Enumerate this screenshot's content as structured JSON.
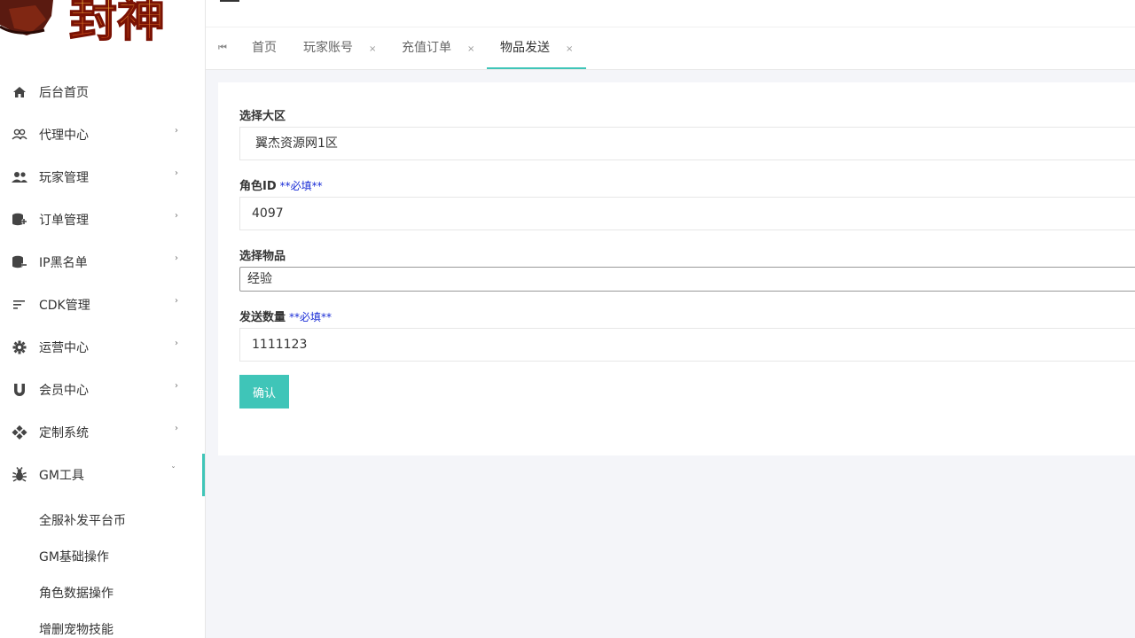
{
  "logo": {
    "text": "封神"
  },
  "sidebar": {
    "items": [
      {
        "label": "后台首页",
        "icon": "home-icon",
        "chevron": ""
      },
      {
        "label": "代理中心",
        "icon": "users-outline-icon",
        "chevron": "›"
      },
      {
        "label": "玩家管理",
        "icon": "people-icon",
        "chevron": "›"
      },
      {
        "label": "订单管理",
        "icon": "database-plus-icon",
        "chevron": "›"
      },
      {
        "label": "IP黑名单",
        "icon": "database-minus-icon",
        "chevron": "›"
      },
      {
        "label": "CDK管理",
        "icon": "sort-lines-icon",
        "chevron": "›"
      },
      {
        "label": "运营中心",
        "icon": "gear-icon",
        "chevron": "›"
      },
      {
        "label": "会员中心",
        "icon": "magnet-icon",
        "chevron": "›"
      },
      {
        "label": "定制系统",
        "icon": "gamepad-icon",
        "chevron": "›"
      },
      {
        "label": "GM工具",
        "icon": "bug-icon",
        "chevron": "ˇ"
      }
    ],
    "submenu": [
      {
        "label": "全服补发平台币"
      },
      {
        "label": "GM基础操作"
      },
      {
        "label": "角色数据操作"
      },
      {
        "label": "增删宠物技能"
      }
    ]
  },
  "tabs": {
    "prev_icon": "⏮",
    "items": [
      {
        "label": "首页",
        "close": ""
      },
      {
        "label": "玩家账号",
        "close": "×"
      },
      {
        "label": "充值订单",
        "close": "×"
      },
      {
        "label": "物品发送",
        "close": "×"
      }
    ]
  },
  "form": {
    "region_label": "选择大区",
    "region_value": "翼杰资源网1区",
    "role_id_label": "角色ID",
    "role_id_required": "**必填**",
    "role_id_value": "4097",
    "item_label": "选择物品",
    "item_value": "经验",
    "quantity_label": "发送数量",
    "quantity_required": "**必填**",
    "quantity_value": "1111123",
    "confirm_label": "确认"
  },
  "colors": {
    "accent": "#3fc5b8",
    "required": "#1a2dd6",
    "background": "#f4f5f9"
  }
}
